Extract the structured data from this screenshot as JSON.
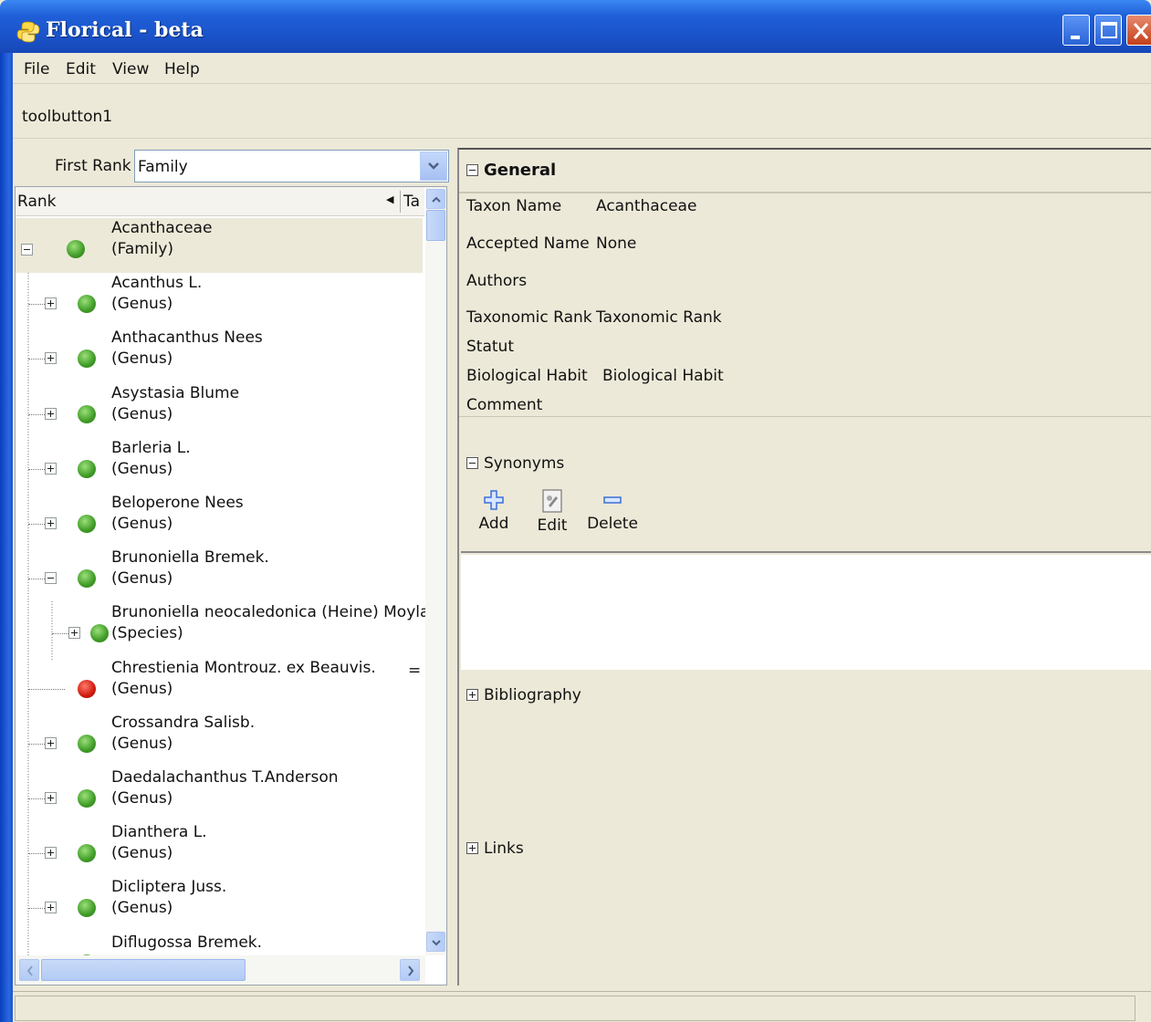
{
  "window": {
    "title": "Florical - beta"
  },
  "menu": [
    "File",
    "Edit",
    "View",
    "Help"
  ],
  "toolbar": {
    "button1": "toolbutton1"
  },
  "first_rank": {
    "label": "First Rank",
    "value": "Family"
  },
  "tree": {
    "header": {
      "rank": "Rank",
      "ta": "Ta"
    },
    "rows": [
      {
        "name": "Acanthaceae",
        "rank": "(Family)",
        "status": "green",
        "expander": "minus"
      },
      {
        "name": "Acanthus L.",
        "rank": "(Genus)",
        "status": "green",
        "expander": "plus"
      },
      {
        "name": "Anthacanthus Nees",
        "rank": "(Genus)",
        "status": "green",
        "expander": "plus"
      },
      {
        "name": "Asystasia Blume",
        "rank": "(Genus)",
        "status": "green",
        "expander": "plus"
      },
      {
        "name": "Barleria L.",
        "rank": "(Genus)",
        "status": "green",
        "expander": "plus"
      },
      {
        "name": "Beloperone Nees",
        "rank": "(Genus)",
        "status": "green",
        "expander": "plus"
      },
      {
        "name": "Brunoniella Bremek.",
        "rank": "(Genus)",
        "status": "green",
        "expander": "minus"
      },
      {
        "name": "Brunoniella neocaledonica (Heine) Moylan",
        "rank": "(Species)",
        "status": "green",
        "expander": "plus"
      },
      {
        "name": "Chrestienia Montrouz. ex Beauvis.",
        "rank": "(Genus)",
        "status": "red",
        "expander": "none",
        "marker": "="
      },
      {
        "name": "Crossandra Salisb.",
        "rank": "(Genus)",
        "status": "green",
        "expander": "plus"
      },
      {
        "name": "Daedalachanthus T.Anderson",
        "rank": "(Genus)",
        "status": "green",
        "expander": "plus"
      },
      {
        "name": "Dianthera L.",
        "rank": "(Genus)",
        "status": "green",
        "expander": "plus"
      },
      {
        "name": "Dicliptera Juss.",
        "rank": "(Genus)",
        "status": "green",
        "expander": "plus"
      },
      {
        "name": "Diflugossa Bremek.",
        "rank": "",
        "status": "green",
        "expander": "plus"
      }
    ]
  },
  "general": {
    "heading": "General",
    "fields": [
      {
        "label": "Taxon Name",
        "value": "Acanthaceae"
      },
      {
        "label": "Accepted Name",
        "value": "None"
      },
      {
        "label": "Authors",
        "value": ""
      },
      {
        "label": "Taxonomic Rank",
        "value": "Taxonomic Rank"
      },
      {
        "label": "Statut",
        "value": ""
      },
      {
        "label": "Biological Habit",
        "value": "Biological Habit"
      },
      {
        "label": "Comment",
        "value": ""
      }
    ]
  },
  "synonyms": {
    "heading": "Synonyms",
    "add": "Add",
    "edit": "Edit",
    "delete": "Delete"
  },
  "bibliography": {
    "heading": "Bibliography"
  },
  "links": {
    "heading": "Links"
  },
  "colors": {
    "titlebar": "#1f5fd8",
    "background": "#ece9d8",
    "ok_status": "#3f9b26",
    "error_status": "#d01a10"
  }
}
